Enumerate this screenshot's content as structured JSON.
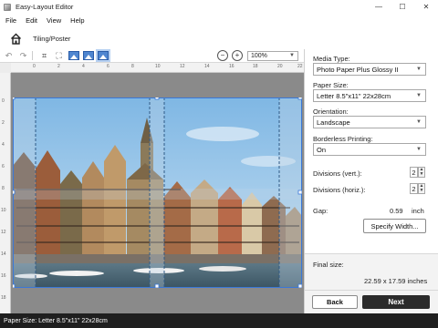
{
  "window": {
    "title": "Easy-Layout Editor",
    "controls": {
      "minimize": "—",
      "maximize": "☐",
      "close": "✕"
    }
  },
  "menu": [
    "File",
    "Edit",
    "View",
    "Help"
  ],
  "nav": {
    "breadcrumb": "Tiling/Poster",
    "home_icon": "home-icon"
  },
  "toolbar": {
    "zoom_value": "100%",
    "icons": [
      "undo-icon",
      "redo-icon",
      "crop-icon",
      "fit-icon",
      "image-fit-icon",
      "image-fill-icon",
      "image-tile-icon",
      "zoom-out-icon",
      "zoom-in-icon"
    ]
  },
  "rulers": {
    "horizontal": [
      "0",
      "2",
      "4",
      "6",
      "8",
      "10",
      "12",
      "14",
      "16",
      "18",
      "20",
      "22"
    ],
    "vertical": [
      "0",
      "2",
      "4",
      "6",
      "8",
      "10",
      "12",
      "14",
      "16",
      "18"
    ]
  },
  "panel": {
    "media_type_label": "Media Type:",
    "media_type_value": "Photo Paper Plus Glossy II",
    "paper_size_label": "Paper Size:",
    "paper_size_value": "Letter 8.5\"x11\" 22x28cm",
    "orientation_label": "Orientation:",
    "orientation_value": "Landscape",
    "borderless_label": "Borderless Printing:",
    "borderless_value": "On",
    "div_vert_label": "Divisions (vert.):",
    "div_vert_value": "2",
    "div_horiz_label": "Divisions (horiz.):",
    "div_horiz_value": "2",
    "gap_label": "Gap:",
    "gap_value": "0.59",
    "gap_unit": "inch",
    "specify_width": "Specify Width...",
    "final_size_label": "Final size:",
    "final_size_value": "22.59 x 17.59 inches",
    "back": "Back",
    "next": "Next"
  },
  "status": {
    "text": "Paper Size: Letter 8.5\"x11\" 22x28cm"
  },
  "colors": {
    "accent": "#2b2b2b",
    "selection": "#3a78d8",
    "sky": "#8cc0e6",
    "water": "#4f6f80"
  }
}
